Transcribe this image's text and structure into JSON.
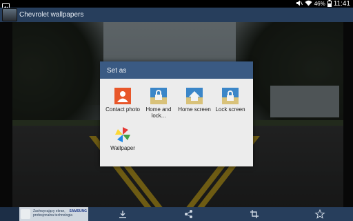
{
  "status_bar": {
    "battery_percent": "46%",
    "time": "11:41",
    "icons": [
      "image-notification-icon",
      "mute-icon",
      "wifi-icon",
      "battery-icon"
    ]
  },
  "app_bar": {
    "title": "Chevrolet wallpapers"
  },
  "dialog": {
    "title": "Set as",
    "options": [
      {
        "label": "Contact photo",
        "icon": "contact-photo-icon"
      },
      {
        "label": "Home and lock...",
        "icon": "home-and-lock-icon"
      },
      {
        "label": "Home screen",
        "icon": "home-screen-icon"
      },
      {
        "label": "Lock screen",
        "icon": "lock-screen-icon"
      },
      {
        "label": "Wallpaper",
        "icon": "wallpaper-pinwheel-icon"
      }
    ]
  },
  "ad_banner": {
    "text": "Zachwycający ekran, profesjonalna technologia",
    "brand": "SAMSUNG"
  },
  "bottom_bar": {
    "icons": [
      "download-icon",
      "share-icon",
      "crop-icon",
      "favorite-star-icon"
    ]
  },
  "colors": {
    "app_bar": "#273e5c",
    "dialog_header": "#3a5a83",
    "dialog_body": "#ececec"
  }
}
